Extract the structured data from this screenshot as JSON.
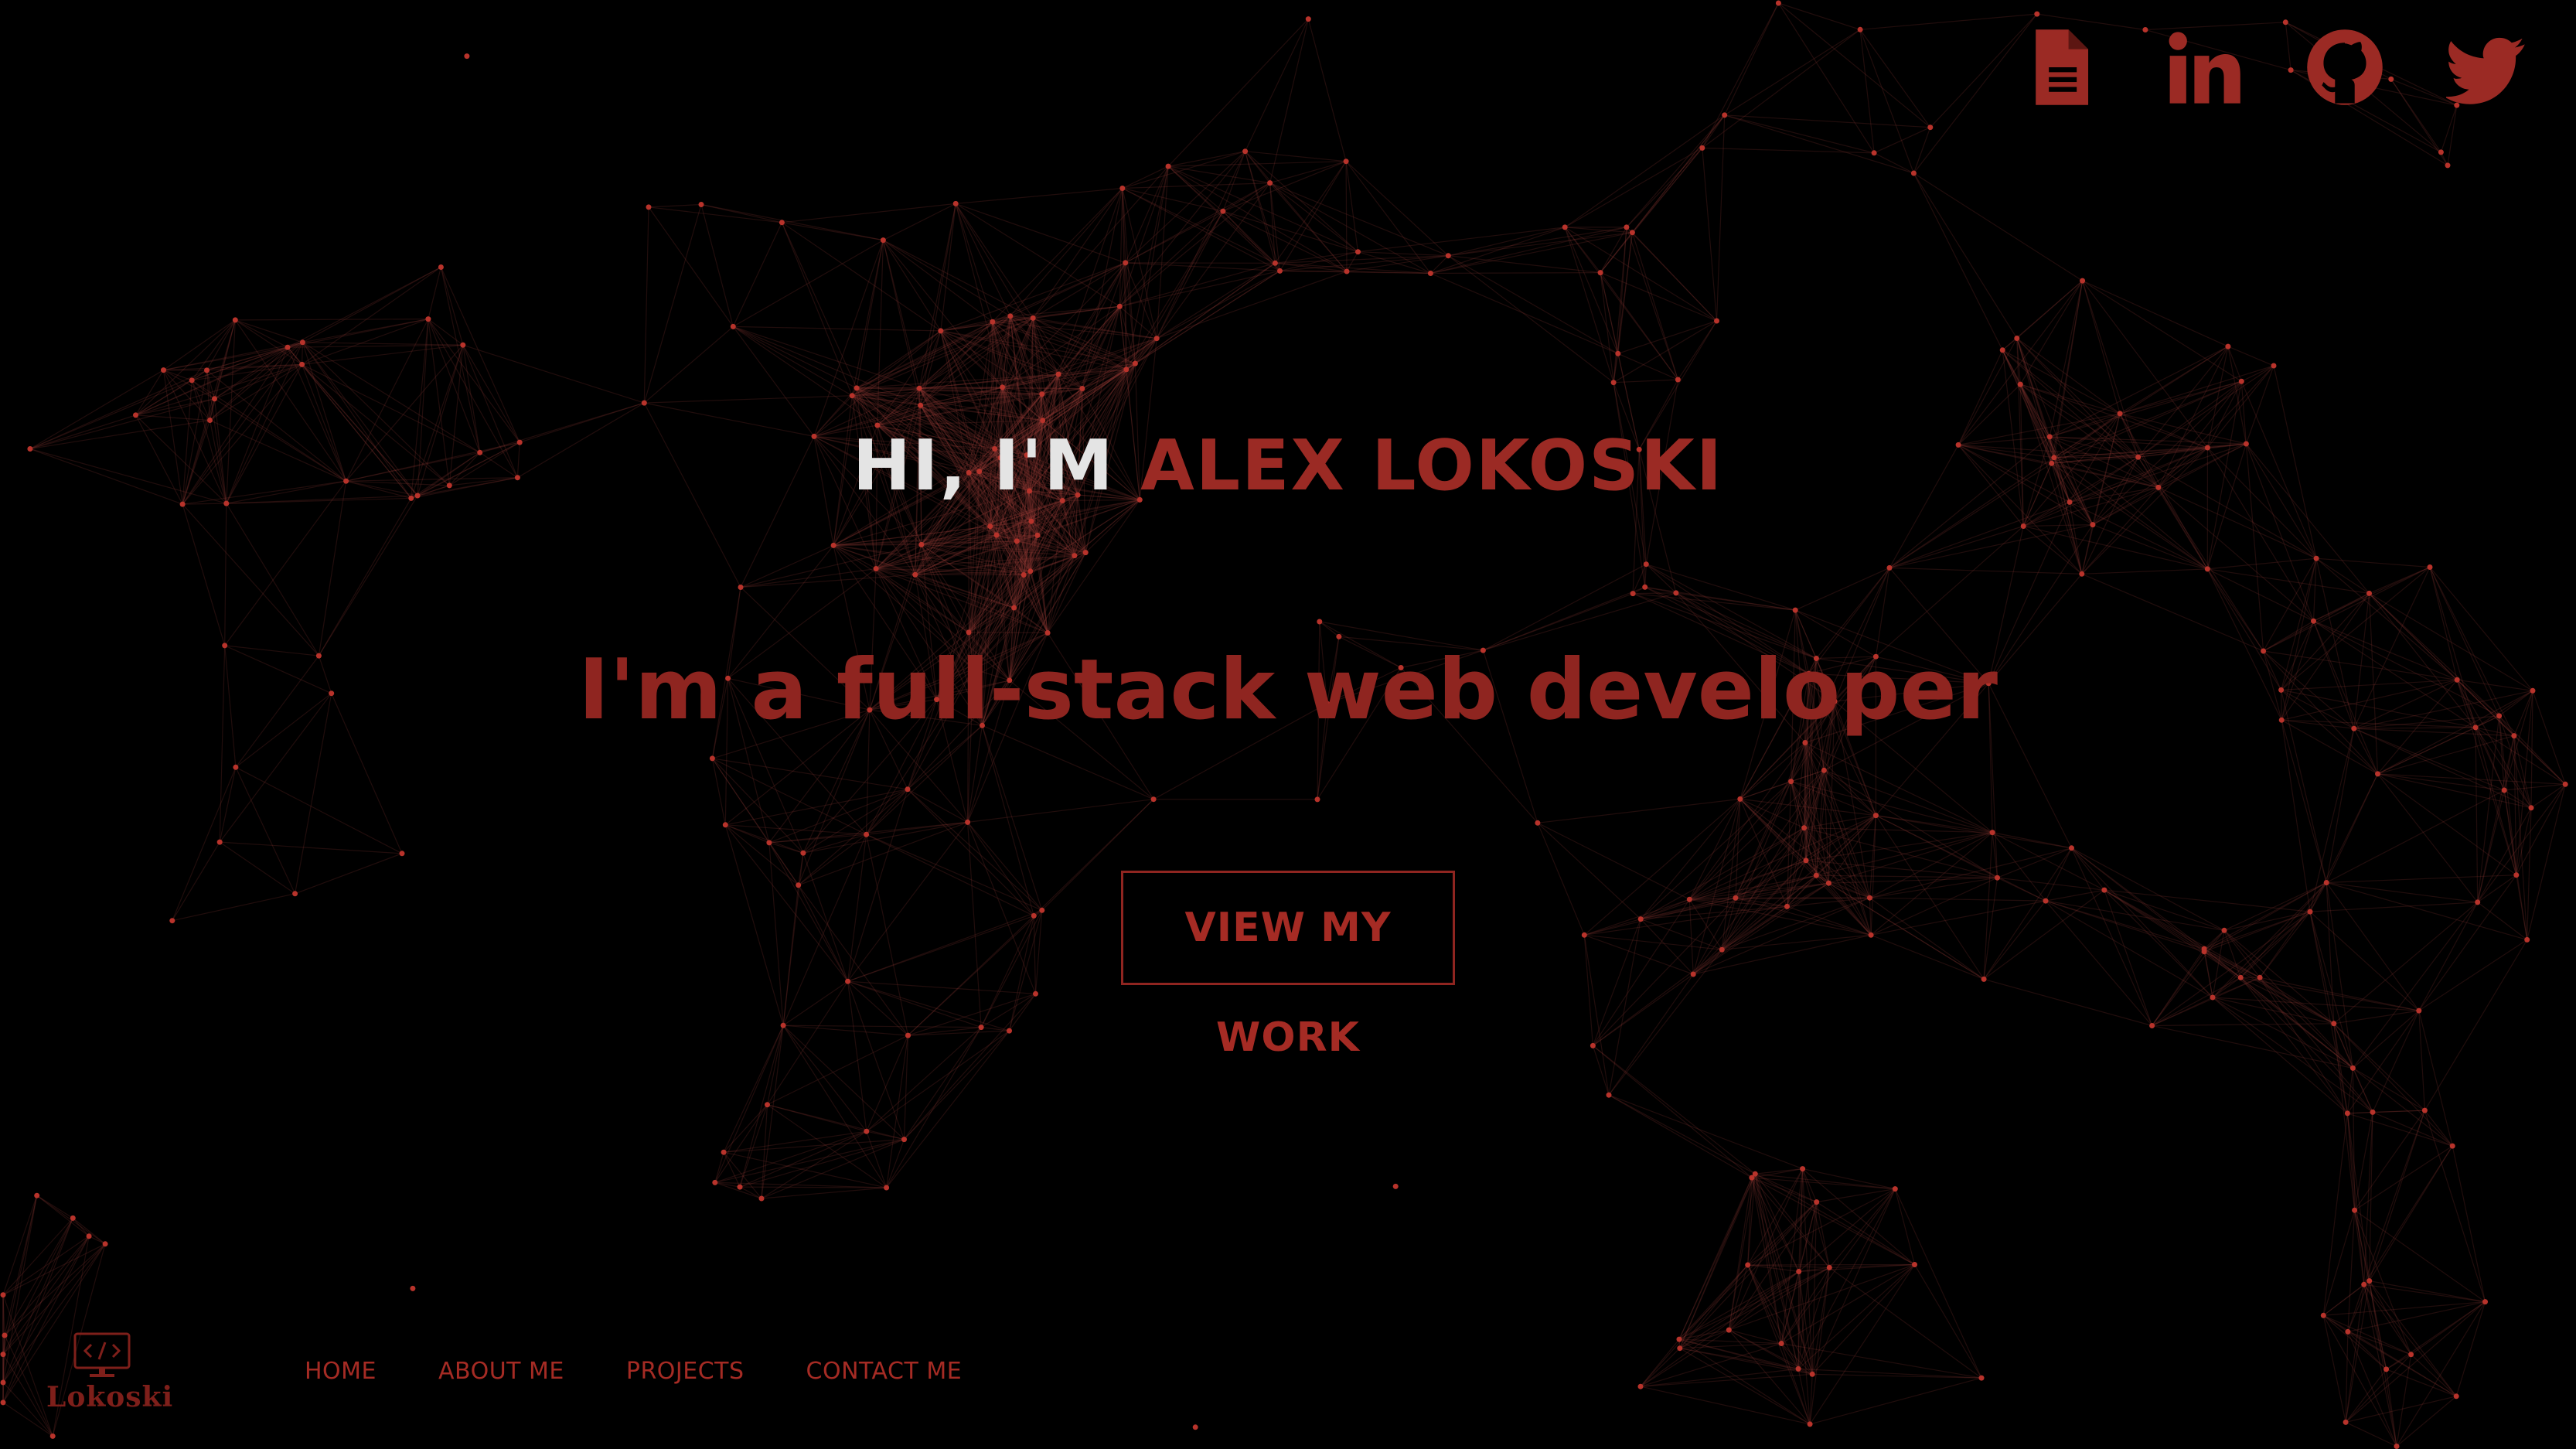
{
  "theme": {
    "background": "#000000",
    "accent": "#9b2a24",
    "greeting_prefix_color": "#e4e4e4"
  },
  "social": [
    {
      "name": "resume",
      "icon": "document-icon"
    },
    {
      "name": "linkedin",
      "icon": "linkedin-icon"
    },
    {
      "name": "github",
      "icon": "github-icon"
    },
    {
      "name": "twitter",
      "icon": "twitter-icon"
    }
  ],
  "hero": {
    "greeting_prefix": "HI, I'M",
    "name": "ALEX LOKOSKI",
    "tagline": "I'm a full-stack web developer",
    "cta_label": "VIEW MY WORK"
  },
  "logo": {
    "icon": "code-monitor-icon",
    "text": "Lokoski"
  },
  "nav": {
    "items": [
      {
        "label": "HOME"
      },
      {
        "label": "ABOUT ME"
      },
      {
        "label": "PROJECTS"
      },
      {
        "label": "CONTACT ME"
      }
    ]
  }
}
